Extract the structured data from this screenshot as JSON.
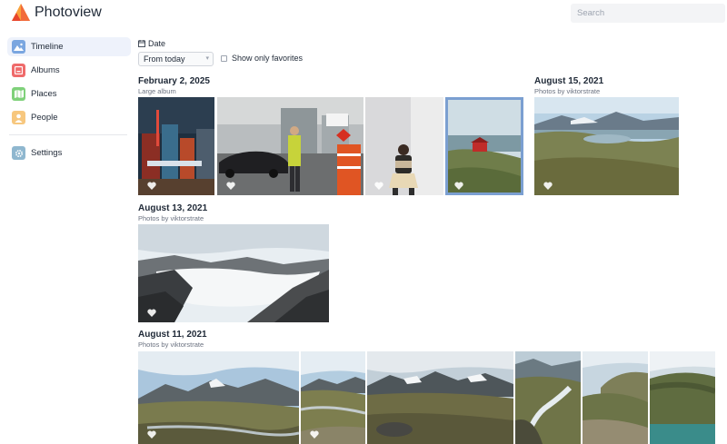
{
  "app": {
    "title": "Photoview"
  },
  "search": {
    "placeholder": "Search"
  },
  "sidebar": {
    "items": [
      {
        "label": "Timeline",
        "active": true,
        "icon": "timeline-icon",
        "color": "#7aa6e0"
      },
      {
        "label": "Albums",
        "active": false,
        "icon": "albums-icon",
        "color": "#ef6b6b"
      },
      {
        "label": "Places",
        "active": false,
        "icon": "places-icon",
        "color": "#7fd17a"
      },
      {
        "label": "People",
        "active": false,
        "icon": "people-icon",
        "color": "#f7c77e"
      },
      {
        "label": "Settings",
        "active": false,
        "icon": "settings-icon",
        "color": "#8fb7cf"
      }
    ]
  },
  "filters": {
    "date_label": "Date",
    "date_value": "From today",
    "favorites_label": "Show only favorites",
    "favorites_checked": false
  },
  "groups": [
    {
      "date": "February 2, 2025",
      "album": "Large album"
    },
    {
      "date": "August 15, 2021",
      "album": "Photos by viktorstrate"
    },
    {
      "date": "August 13, 2021",
      "album": "Photos by viktorstrate"
    },
    {
      "date": "August 11, 2021",
      "album": "Photos by viktorstrate"
    }
  ],
  "colors": {
    "accent": "#7b9fd1",
    "selected_border": "#7b9fd1",
    "brand": "#f26b3a"
  }
}
